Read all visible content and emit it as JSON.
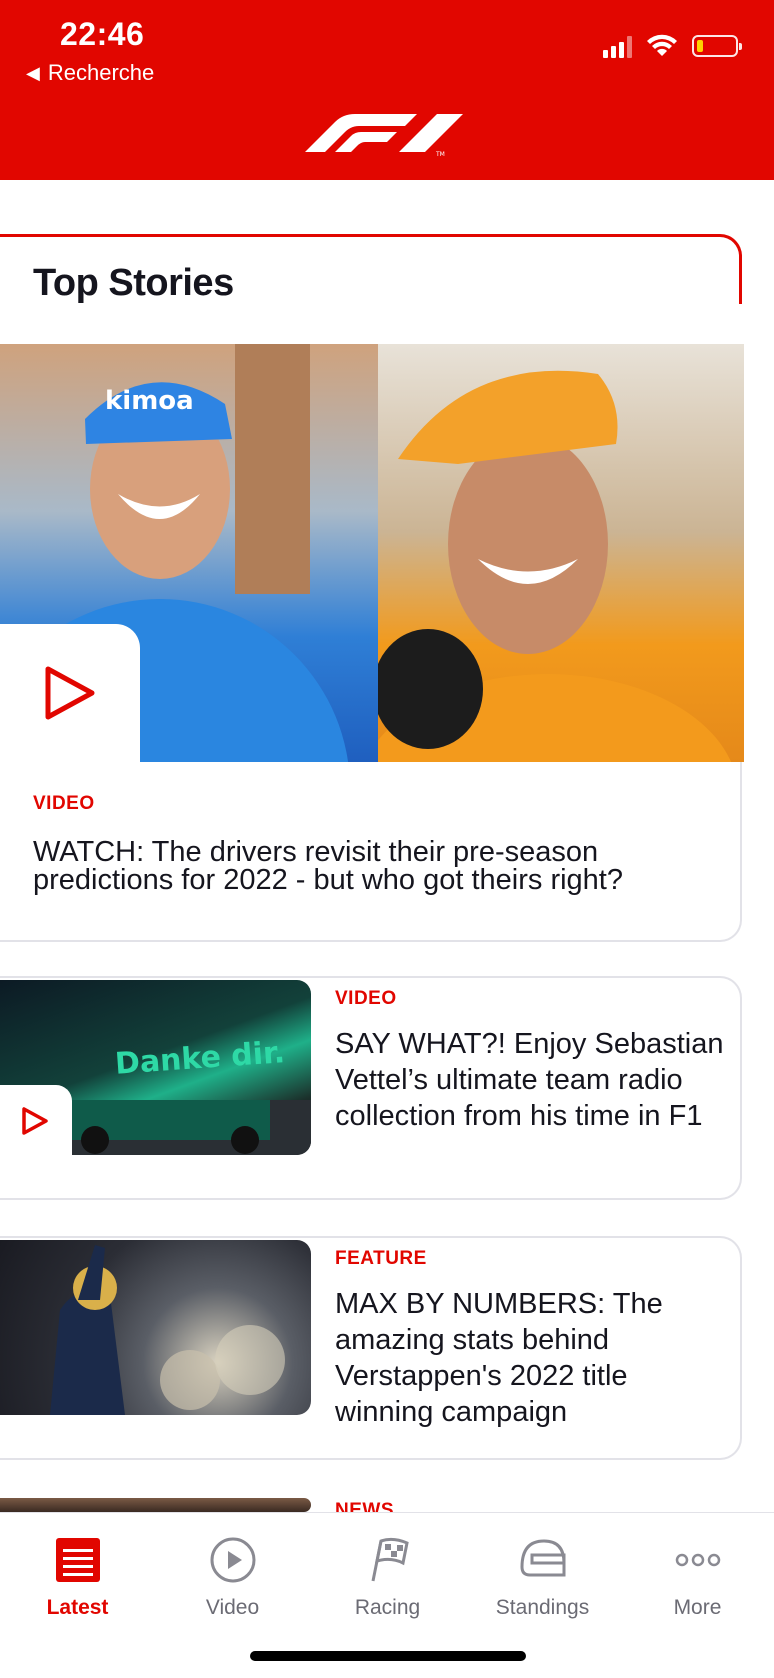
{
  "status_bar": {
    "time": "22:46",
    "back_label": "Recherche"
  },
  "colors": {
    "brand": "#e10600",
    "text": "#15151e",
    "muted": "#6b6b74"
  },
  "section": {
    "title": "Top Stories"
  },
  "hero": {
    "label": "VIDEO",
    "title": "WATCH: The drivers revisit their pre-season predictions for 2022 - but who got theirs right?",
    "image_text_left": "kimoa",
    "image_text_right": ""
  },
  "cards": [
    {
      "label": "VIDEO",
      "title": "SAY WHAT?! Enjoy Sebastian Vettel’s ultimate team radio collection from his time in F1",
      "image_text": "Danke dir."
    },
    {
      "label": "FEATURE",
      "title": "MAX BY NUMBERS: The amazing stats behind Verstappen's 2022 title winning campaign"
    },
    {
      "label": "NEWS"
    }
  ],
  "nav": [
    {
      "label": "Latest",
      "icon": "latest-icon",
      "active": true
    },
    {
      "label": "Video",
      "icon": "play-icon",
      "active": false
    },
    {
      "label": "Racing",
      "icon": "flag-icon",
      "active": false
    },
    {
      "label": "Standings",
      "icon": "helmet-icon",
      "active": false
    },
    {
      "label": "More",
      "icon": "more-icon",
      "active": false
    }
  ]
}
